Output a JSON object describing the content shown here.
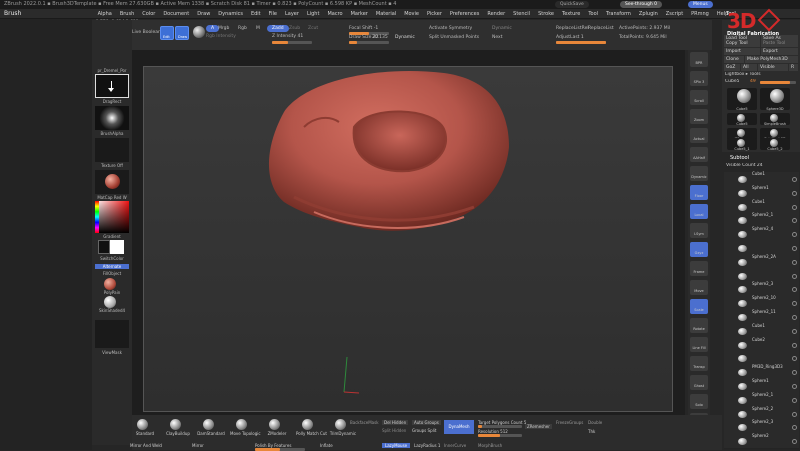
{
  "app": {
    "titlebar_text": "ZBrush 2022.0.1 ▪ Brush3DTemplate ▪ Free Mem 27.630GB ▪ Active Mem 1338 ▪ Scratch Disk 81 ▪ Timer ▪ 0.823 ▪ PolyCount ▪ 6.598 KP ▪ MeshCount ▪ 4",
    "quicksave": "QuickSave",
    "see_through": "See-through 0",
    "menus_btn": "Menus",
    "script": "DefaultZScript"
  },
  "menu": [
    "Alpha",
    "Brush",
    "Color",
    "Document",
    "Draw",
    "Dynamics",
    "Edit",
    "File",
    "Layer",
    "Light",
    "Macro",
    "Marker",
    "Material",
    "Movie",
    "Picker",
    "Preferences",
    "Render",
    "Stencil",
    "Stroke",
    "Texture",
    "Tool",
    "Transform",
    "Zplugin",
    "Zscript",
    "PRmng",
    "Help"
  ],
  "palette_label": "Brush",
  "coords": "-0.776,-0.614,1.611",
  "left": {
    "lightbox": "LightBox",
    "live_boolean": "Live Boolean",
    "brush_name": "pr_Dremel_Por",
    "drag_rect": "DragRect",
    "brush_alpha": "BrushAlpha",
    "texture_off": "Texture Off",
    "matcap": "MatCap Red W",
    "gradient": "Gradient",
    "switch_color": "SwitchColor",
    "alternate": "Alternate",
    "fillobject": "FillObject",
    "polypaint": "PolyPain",
    "skinshaded": "SkinShaded4",
    "viewmask": "ViewMask"
  },
  "toolbar": {
    "edit": "Edit",
    "draw": "Draw",
    "mrgb": "Mrgb",
    "rgb": "Rgb",
    "m": "M",
    "zadd": "Zadd",
    "zsub": "Zsub",
    "zcut": "Zcut",
    "rgb_intensity": "Rgb Intensity",
    "z_intensity": "Z Intensity 41",
    "focal_shift": "Focal Shift -1",
    "draw_size": "Draw Size 22",
    "draw_size_val": "20.135",
    "dynamic": "Dynamic",
    "activate_symmetry": "Activate Symmetry",
    "split_unmasked": "Split Unmasked Points",
    "dynamesh": "Dynamic",
    "next": "Next",
    "replace_list_rel": "ReplaceListRel",
    "replace_list": "ReplaceList",
    "adjust_last": "AdjustLast 1",
    "active_points": "ActivePoints: 2.937 Mil",
    "total_points": "TotalPoints: 9.645 Mil"
  },
  "right_strip": [
    "BPR",
    "SPix 3",
    "Scroll",
    "Zoom",
    "Actual",
    "AAHalf",
    "Dynamic Persp",
    "Floor",
    "Local",
    "LSym",
    "Gxyz",
    "Frame",
    "Move",
    "Scale",
    "Rotate",
    "Line Fill PolyF",
    "Transp",
    "Ghost",
    "Solo",
    "Xpose"
  ],
  "tool": {
    "title": "Tool",
    "logo_text": "3D",
    "logo_sub": "Digital Fabrication",
    "load_tool": "Load Tool",
    "save_as": "Save As",
    "copy_tool": "Copy Tool",
    "paste_tool": "Paste Tool",
    "import": "Import",
    "export": "Export",
    "clone": "Clone",
    "make_polymesh": "Make PolyMesh3D",
    "goz": "GoZ",
    "all": "All",
    "visible": "Visible",
    "r": "R",
    "lightbox_tools": "Lightbox ▸ Tools",
    "current": "Cube5",
    "count": "49",
    "thumbs": [
      "Cube5",
      "Sphere3D",
      "Cube5",
      "SimpleBrush",
      "ZSphere",
      "PolyMesh3D",
      "Cube5_1",
      "Cube5_2"
    ]
  },
  "subtool": {
    "title": "Subtool",
    "visible_count": "Visible Count 24",
    "items": [
      "Cube1",
      "Sphere1",
      "Cube1",
      "Sphere2_1",
      "Sphere2_4",
      "",
      "Sphere2_2A",
      "",
      "Sphere2_3",
      "Sphere2_10",
      "Sphere2_11",
      "Cube1",
      "Cube2",
      "",
      "PM3D_Ring3D3",
      "Sphere1",
      "Sphere2_1",
      "Sphere2_2",
      "Sphere2_3",
      "Sphere2"
    ]
  },
  "bottom": {
    "brushes": [
      "Standard",
      "ClayBuildup",
      "DamStandard",
      "Move Topologic",
      "ZModeler",
      "Polly Match Cut",
      "TrimDynamic"
    ],
    "mirror_weld": "Mirror And Weld",
    "mirror": "Mirror",
    "polish_features": "Polish By Features",
    "inflate": "Inflate",
    "backface_mask": "BackfaceMask",
    "del_hidden": "Del Hidden",
    "auto_groups": "Auto Groups",
    "split_hidden": "Split Hidden",
    "groups_split": "Groups Split",
    "dynamesh": "DynaMesh",
    "target_poly": "Target Polygons Count 5",
    "resolution": "Resolution 512",
    "zremesher": "ZRemesher",
    "lazy_mouse": "LazyMouse",
    "lazy_radius": "LazyRadius 1",
    "freeze_group": "FreezeGroups",
    "double": "Double",
    "thk": "Thk",
    "inner_curve": "InnerCurve",
    "morph_brush": "MorphBrush"
  },
  "colors": {
    "accent": "#3d6fd6",
    "clay": "#b4554a",
    "orange": "#e8873a",
    "logo_red": "#d42a2a"
  }
}
